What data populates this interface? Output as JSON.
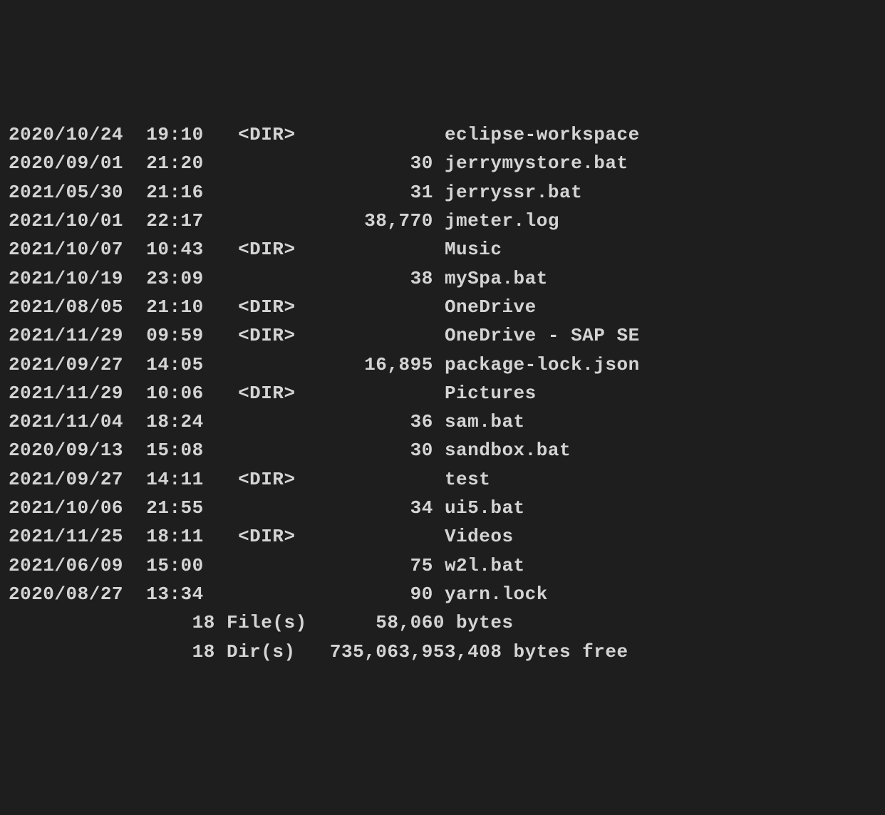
{
  "entries": [
    {
      "date": "2020/10/24",
      "time": "19:10",
      "dir": true,
      "size": "",
      "name": "eclipse-workspace"
    },
    {
      "date": "2020/09/01",
      "time": "21:20",
      "dir": false,
      "size": "30",
      "name": "jerrymystore.bat"
    },
    {
      "date": "2021/05/30",
      "time": "21:16",
      "dir": false,
      "size": "31",
      "name": "jerryssr.bat"
    },
    {
      "date": "2021/10/01",
      "time": "22:17",
      "dir": false,
      "size": "38,770",
      "name": "jmeter.log"
    },
    {
      "date": "2021/10/07",
      "time": "10:43",
      "dir": true,
      "size": "",
      "name": "Music"
    },
    {
      "date": "2021/10/19",
      "time": "23:09",
      "dir": false,
      "size": "38",
      "name": "mySpa.bat"
    },
    {
      "date": "2021/08/05",
      "time": "21:10",
      "dir": true,
      "size": "",
      "name": "OneDrive"
    },
    {
      "date": "2021/11/29",
      "time": "09:59",
      "dir": true,
      "size": "",
      "name": "OneDrive - SAP SE"
    },
    {
      "date": "2021/09/27",
      "time": "14:05",
      "dir": false,
      "size": "16,895",
      "name": "package-lock.json"
    },
    {
      "date": "2021/11/29",
      "time": "10:06",
      "dir": true,
      "size": "",
      "name": "Pictures"
    },
    {
      "date": "2021/11/04",
      "time": "18:24",
      "dir": false,
      "size": "36",
      "name": "sam.bat"
    },
    {
      "date": "2020/09/13",
      "time": "15:08",
      "dir": false,
      "size": "30",
      "name": "sandbox.bat"
    },
    {
      "date": "2021/09/27",
      "time": "14:11",
      "dir": true,
      "size": "",
      "name": "test"
    },
    {
      "date": "2021/10/06",
      "time": "21:55",
      "dir": false,
      "size": "34",
      "name": "ui5.bat"
    },
    {
      "date": "2021/11/25",
      "time": "18:11",
      "dir": true,
      "size": "",
      "name": "Videos"
    },
    {
      "date": "2021/06/09",
      "time": "15:00",
      "dir": false,
      "size": "75",
      "name": "w2l.bat"
    },
    {
      "date": "2020/08/27",
      "time": "13:34",
      "dir": false,
      "size": "90",
      "name": "yarn.lock"
    }
  ],
  "summary": {
    "file_count": "18",
    "file_label": "File(s)",
    "file_bytes": "58,060 bytes",
    "dir_count": "18",
    "dir_label": "Dir(s)",
    "dir_bytes": "735,063,953,408 bytes free"
  },
  "dir_marker": "<DIR>"
}
